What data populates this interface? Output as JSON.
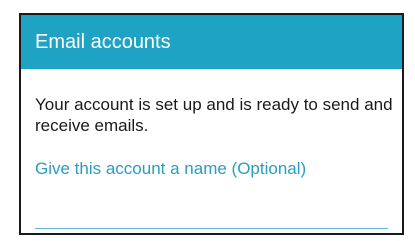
{
  "header": {
    "title": "Email accounts"
  },
  "content": {
    "message": "Your account is set up and is ready to send and receive emails.",
    "name_label": "Give this account a name (Optional)",
    "name_value": ""
  },
  "colors": {
    "header_background": "#1ea3c4",
    "accent": "#2a9dc0",
    "input_underline": "#5bbad6",
    "text": "#1a1a1a"
  }
}
